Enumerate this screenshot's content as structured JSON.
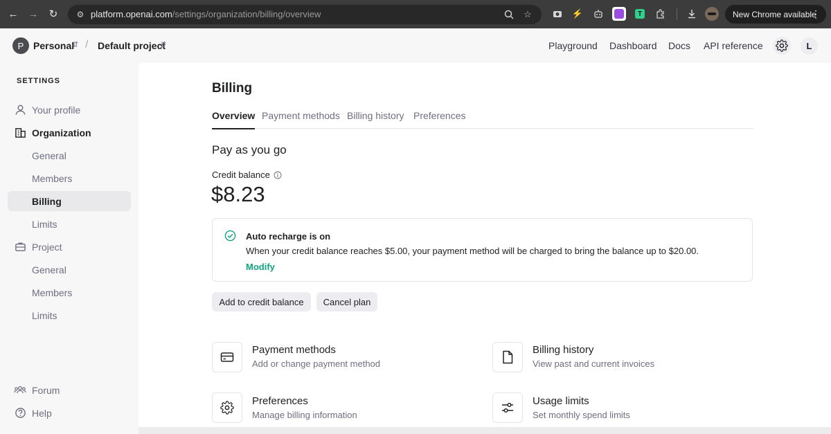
{
  "browser": {
    "url_host": "platform.openai.com",
    "url_path": "/settings/organization/billing/overview",
    "new_chrome_label": "New Chrome available",
    "icons": [
      "back-icon",
      "forward-icon",
      "reload-icon",
      "site-info-icon",
      "zoom-icon",
      "bookmark-star-icon",
      "extension-camera-icon",
      "extension-bolt-icon",
      "extension-robot-icon",
      "extension-purple-icon",
      "extension-t-icon",
      "extensions-puzzle-icon",
      "download-icon",
      "profile-avatar-icon",
      "more-dots-icon"
    ]
  },
  "header": {
    "org_initial": "P",
    "org_name": "Personal",
    "project_name": "Default project",
    "links": [
      "Playground",
      "Dashboard",
      "Docs",
      "API reference"
    ],
    "user_initial": "L"
  },
  "sidebar": {
    "heading": "SETTINGS",
    "items": [
      {
        "label": "Your profile",
        "icon": "person-icon"
      },
      {
        "label": "Organization",
        "icon": "building-icon"
      },
      {
        "label": "General"
      },
      {
        "label": "Members"
      },
      {
        "label": "Billing",
        "active": true
      },
      {
        "label": "Limits"
      },
      {
        "label": "Project",
        "icon": "briefcase-icon"
      },
      {
        "label": "General"
      },
      {
        "label": "Members"
      },
      {
        "label": "Limits"
      }
    ],
    "footer": [
      {
        "label": "Forum",
        "icon": "people-icon"
      },
      {
        "label": "Help",
        "icon": "help-circle-icon"
      }
    ]
  },
  "main": {
    "title": "Billing",
    "tabs": [
      "Overview",
      "Payment methods",
      "Billing history",
      "Preferences"
    ],
    "plan": "Pay as you go",
    "credit_label": "Credit balance",
    "credit_value": "$8.23",
    "recharge": {
      "title": "Auto recharge is on",
      "description": "When your credit balance reaches $5.00, your payment method will be charged to bring the balance up to $20.00.",
      "modify": "Modify"
    },
    "buttons": {
      "add_credit": "Add to credit balance",
      "cancel_plan": "Cancel plan"
    },
    "cards": [
      {
        "title": "Payment methods",
        "subtitle": "Add or change payment method",
        "icon": "credit-card-icon"
      },
      {
        "title": "Billing history",
        "subtitle": "View past and current invoices",
        "icon": "document-icon"
      },
      {
        "title": "Preferences",
        "subtitle": "Manage billing information",
        "icon": "gear-icon"
      },
      {
        "title": "Usage limits",
        "subtitle": "Set monthly spend limits",
        "icon": "sliders-icon"
      }
    ]
  },
  "colors": {
    "accent_green": "#10a37f",
    "active_item_bg": "#e9e9ec",
    "chrome_bar": "#3c3c3c"
  }
}
